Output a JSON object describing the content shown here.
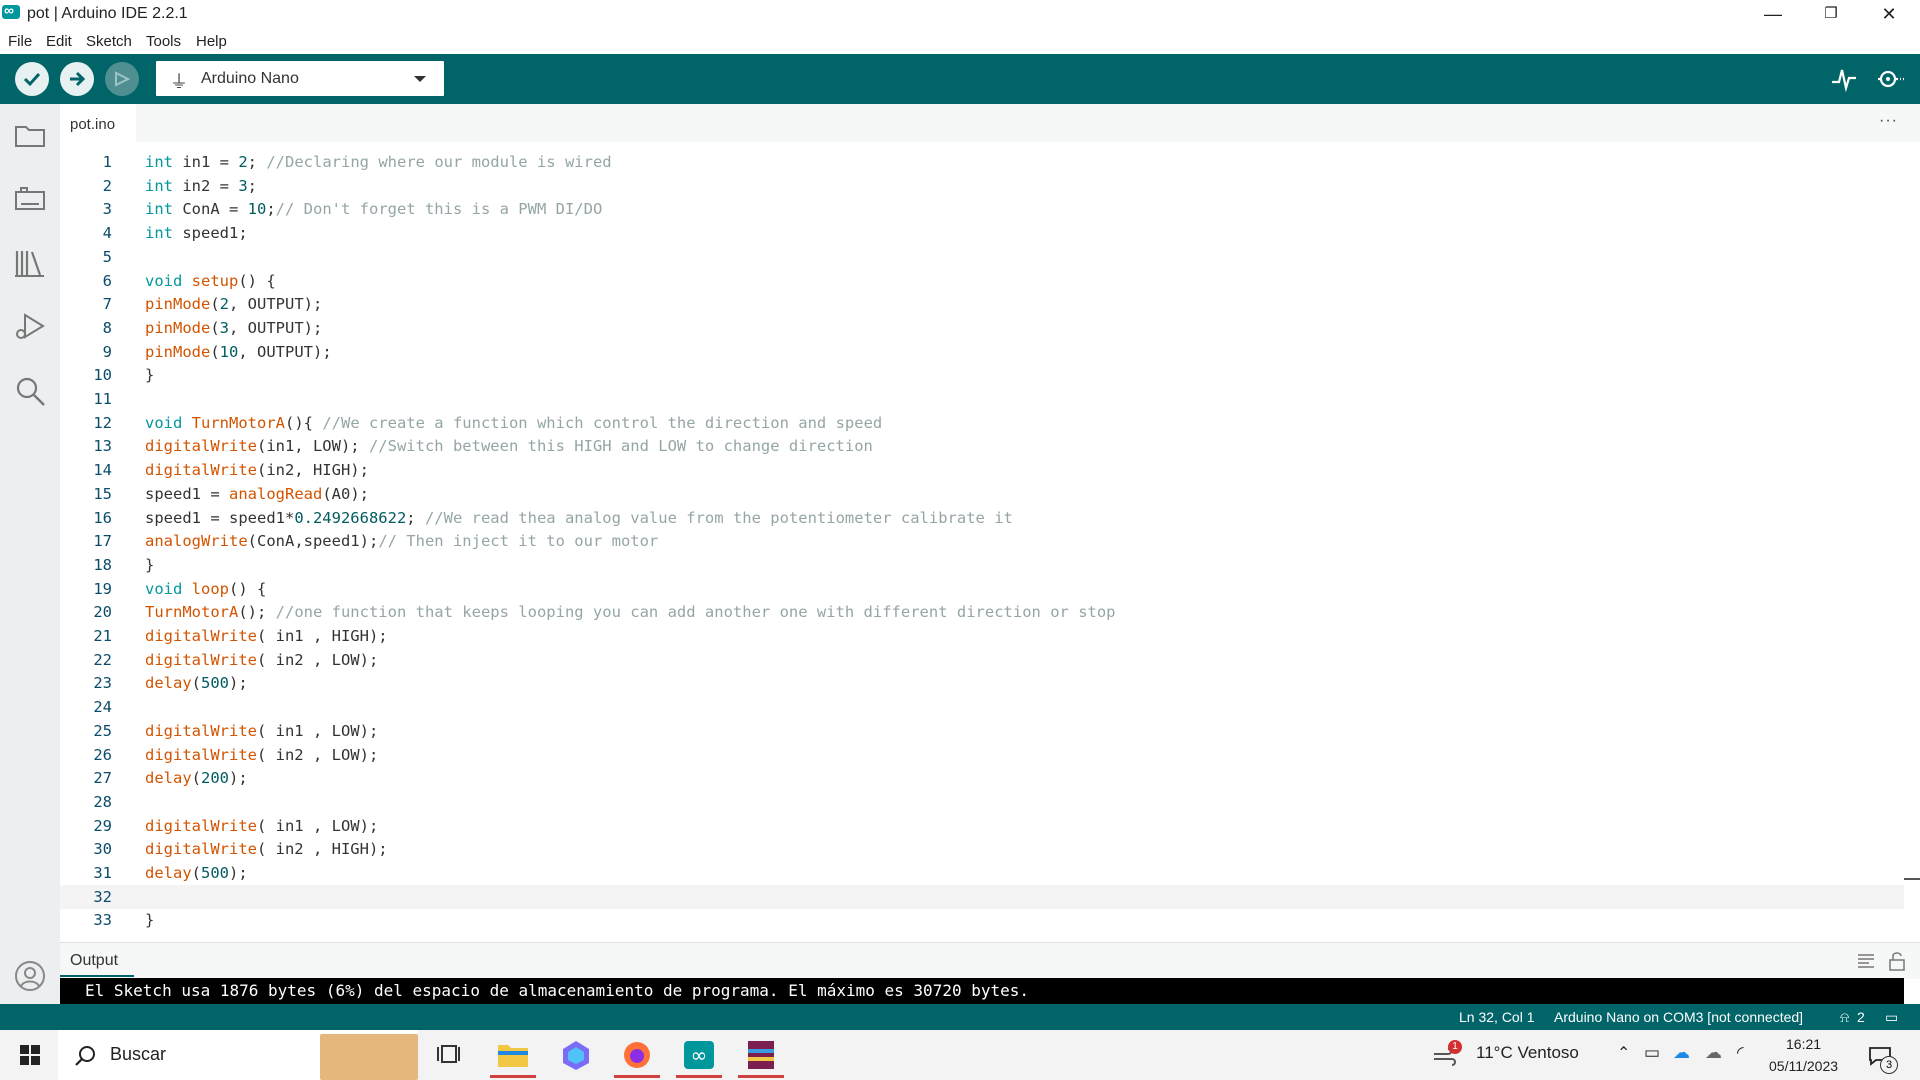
{
  "window": {
    "title": "pot | Arduino IDE 2.2.1",
    "minimize": "—",
    "restore": "❐",
    "close": "✕"
  },
  "menu": [
    "File",
    "Edit",
    "Sketch",
    "Tools",
    "Help"
  ],
  "toolbar": {
    "board": "Arduino Nano"
  },
  "tabs": {
    "active": "pot.ino",
    "more": "···"
  },
  "code_lines": [
    {
      "n": "1",
      "html": "<span class='kw'>int</span> in1 = <span class='num'>2</span>; <span class='cm'>//Declaring where our module is wired</span>"
    },
    {
      "n": "2",
      "html": "<span class='kw'>int</span> in2 = <span class='num'>3</span>;"
    },
    {
      "n": "3",
      "html": "<span class='kw'>int</span> ConA = <span class='num'>10</span>;<span class='cm'>// Don't forget this is a PWM DI/DO</span>"
    },
    {
      "n": "4",
      "html": "<span class='kw'>int</span> speed1;"
    },
    {
      "n": "5",
      "html": ""
    },
    {
      "n": "6",
      "html": "<span class='kw'>void</span> <span class='fn'>setup</span>() {"
    },
    {
      "n": "7",
      "html": "<span class='fn'>pinMode</span>(<span class='num'>2</span>, OUTPUT);"
    },
    {
      "n": "8",
      "html": "<span class='fn'>pinMode</span>(<span class='num'>3</span>, OUTPUT);"
    },
    {
      "n": "9",
      "html": "<span class='fn'>pinMode</span>(<span class='num'>10</span>, OUTPUT);"
    },
    {
      "n": "10",
      "html": "}"
    },
    {
      "n": "11",
      "html": ""
    },
    {
      "n": "12",
      "html": "<span class='kw'>void</span> <span class='fn'>TurnMotorA</span>(){ <span class='cm'>//We create a function which control the direction and speed</span>"
    },
    {
      "n": "13",
      "html": "<span class='fn'>digitalWrite</span>(in1, LOW); <span class='cm'>//Switch between this HIGH and LOW to change direction</span>"
    },
    {
      "n": "14",
      "html": "<span class='fn'>digitalWrite</span>(in2, HIGH);"
    },
    {
      "n": "15",
      "html": "speed1 = <span class='fn'>analogRead</span>(A0);"
    },
    {
      "n": "16",
      "html": "speed1 = speed1*<span class='num'>0.2492668622</span>; <span class='cm'>//We read thea analog value from the potentiometer calibrate it</span>"
    },
    {
      "n": "17",
      "html": "<span class='fn'>analogWrite</span>(ConA,speed1);<span class='cm'>// Then inject it to our motor</span>"
    },
    {
      "n": "18",
      "html": "}"
    },
    {
      "n": "19",
      "html": "<span class='kw'>void</span> <span class='fn'>loop</span>() {"
    },
    {
      "n": "20",
      "html": "<span class='fn'>TurnMotorA</span>(); <span class='cm'>//one function that keeps looping you can add another one with different direction or stop</span>"
    },
    {
      "n": "21",
      "html": "<span class='fn'>digitalWrite</span>( in1 , HIGH);"
    },
    {
      "n": "22",
      "html": "<span class='fn'>digitalWrite</span>( in2 , LOW);"
    },
    {
      "n": "23",
      "html": "<span class='fn'>delay</span>(<span class='num'>500</span>);"
    },
    {
      "n": "24",
      "html": ""
    },
    {
      "n": "25",
      "html": "<span class='fn'>digitalWrite</span>( in1 , LOW);"
    },
    {
      "n": "26",
      "html": "<span class='fn'>digitalWrite</span>( in2 , LOW);"
    },
    {
      "n": "27",
      "html": "<span class='fn'>delay</span>(<span class='num'>200</span>);"
    },
    {
      "n": "28",
      "html": ""
    },
    {
      "n": "29",
      "html": "<span class='fn'>digitalWrite</span>( in1 , LOW);"
    },
    {
      "n": "30",
      "html": "<span class='fn'>digitalWrite</span>( in2 , HIGH);"
    },
    {
      "n": "31",
      "html": "<span class='fn'>delay</span>(<span class='num'>500</span>);"
    },
    {
      "n": "32",
      "html": ""
    },
    {
      "n": "33",
      "html": "}"
    }
  ],
  "active_line": "32",
  "output": {
    "label": "Output",
    "message": "El Sketch usa 1876 bytes (6%) del espacio de almacenamiento de programa. El máximo es 30720 bytes."
  },
  "status": {
    "position": "Ln 32, Col 1",
    "board": "Arduino Nano on COM3 [not connected]",
    "notifications": "2"
  },
  "taskbar": {
    "search": "Buscar",
    "weather": "11°C  Ventoso",
    "weather_badge": "1",
    "time": "16:21",
    "date": "05/11/2023",
    "notif_count": "3"
  },
  "colors": {
    "teal": "#006468",
    "accent": "#00979c"
  }
}
